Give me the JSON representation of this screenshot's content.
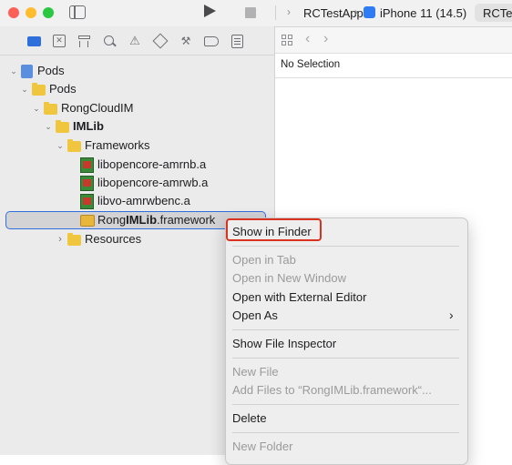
{
  "toolbar": {
    "scheme": "RCTestApp",
    "device": "iPhone 11 (14.5)",
    "scheme_tab": "RCTest"
  },
  "navigator_icons": [
    "folder-icon",
    "source-control-icon",
    "hierarchy-icon",
    "search-icon",
    "issue-icon",
    "test-icon",
    "debug-icon",
    "breakpoint-icon",
    "report-icon"
  ],
  "editor": {
    "status": "No Selection"
  },
  "tree": [
    {
      "label": "Pods",
      "bold": false
    },
    {
      "label": "Pods",
      "bold": false
    },
    {
      "label": "RongCloudIM",
      "bold": false
    },
    {
      "label": "IMLib",
      "bold": true
    },
    {
      "label": "Frameworks",
      "bold": false
    },
    {
      "label": "libopencore-amrnb.a",
      "bold": false
    },
    {
      "label": "libopencore-amrwb.a",
      "bold": false
    },
    {
      "label": "libvo-amrwbenc.a",
      "bold": false
    },
    {
      "label_pre": "Rong",
      "label_bold": "IMLib",
      "label_post": ".framework",
      "selected": true
    },
    {
      "label": "Resources",
      "bold": false
    }
  ],
  "context_menu": {
    "items": [
      {
        "label": "Show in Finder",
        "enabled": true,
        "highlighted": true
      },
      {
        "label": "Open in Tab",
        "enabled": false
      },
      {
        "label": "Open in New Window",
        "enabled": false
      },
      {
        "label": "Open with External Editor",
        "enabled": true
      },
      {
        "label": "Open As",
        "enabled": true,
        "submenu": true
      },
      {
        "label": "Show File Inspector",
        "enabled": true
      },
      {
        "label": "New File",
        "enabled": false
      },
      {
        "label": "Add Files to “RongIMLib.framework“...",
        "enabled": false
      },
      {
        "label": "Delete",
        "enabled": true
      },
      {
        "label": "New Folder",
        "enabled": false
      }
    ],
    "highlight_color": "#d9331f"
  },
  "colors": {
    "accent": "#2f6fdc",
    "close": "#fe5f57",
    "minimize": "#febc2e",
    "zoom": "#28c840"
  }
}
